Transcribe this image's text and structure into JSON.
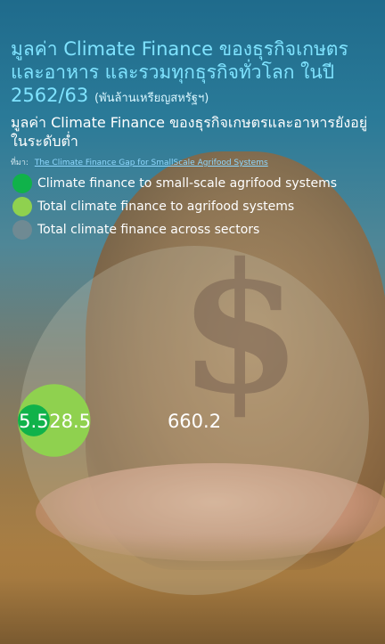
{
  "title": "มูลค่า Climate Finance ของธุรกิจเกษตรและอาหาร และรวมทุกธุรกิจทั่วโลก ในปี 2562/63",
  "title_unit": "(พันล้านเหรียญสหรัฐฯ)",
  "subtitle": "มูลค่า Climate Finance ของธุรกิจเกษตรและอาหารยังอยู่ในระดับต่ำ",
  "source_label": "ที่มา:",
  "source_text": "The Climate Finance Gap for SmallScale Agrifood Systems",
  "legend": [
    {
      "label": "Climate finance to small-scale agrifood systems",
      "color": "#10b24a"
    },
    {
      "label": "Total climate finance to agrifood systems",
      "color": "#8fd14f"
    },
    {
      "label": "Total climate finance across sectors",
      "color": "#6f8a93"
    }
  ],
  "chart_data": {
    "type": "bubble",
    "title": "มูลค่า Climate Finance ของธุรกิจเกษตรและอาหาร และรวมทุกธุรกิจทั่วโลก ในปี 2562/63",
    "unit": "(พันล้านเหรียญสหรัฐฯ)",
    "series": [
      {
        "name": "Climate finance to small-scale agrifood systems",
        "value": 5.5,
        "label": "5.5",
        "color": "#10b24a"
      },
      {
        "name": "Total climate finance to agrifood systems",
        "value": 28.5,
        "label": "28.5",
        "color": "#8fd14f"
      },
      {
        "name": "Total climate finance across sectors",
        "value": 660.2,
        "label": "660.2",
        "color": "#c8c8b8"
      }
    ]
  }
}
